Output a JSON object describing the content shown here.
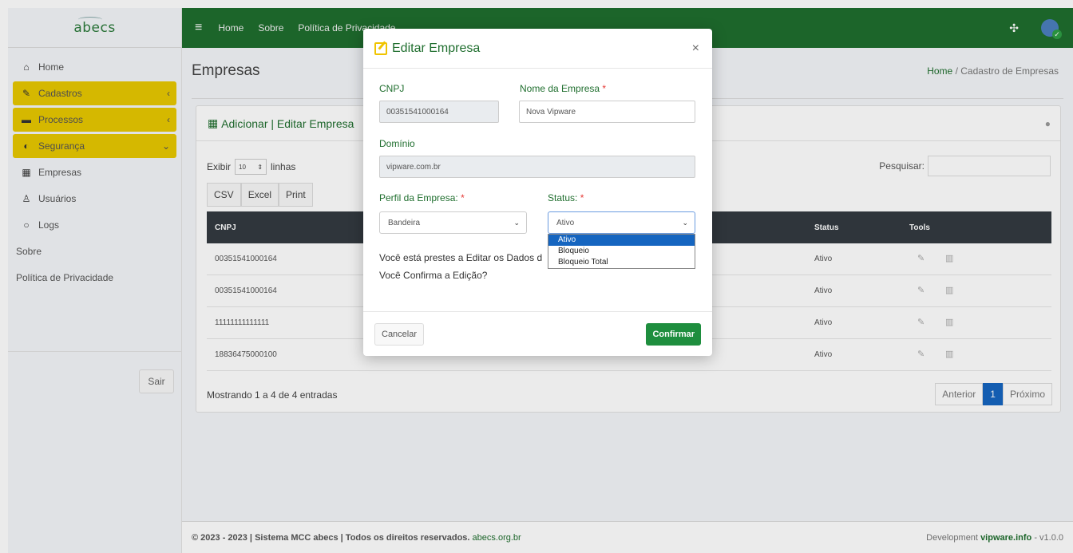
{
  "brand": {
    "name": "abecs"
  },
  "sidebar": {
    "items": [
      {
        "label": "Home",
        "icon": "home-icon",
        "glyph": "⌂"
      },
      {
        "label": "Cadastros",
        "icon": "edit-icon",
        "glyph": "✎"
      },
      {
        "label": "Processos",
        "icon": "server-icon",
        "glyph": "▬"
      },
      {
        "label": "Segurança",
        "icon": "shield-icon",
        "glyph": "◐"
      },
      {
        "label": "Empresas",
        "icon": "building-icon",
        "glyph": "▦"
      },
      {
        "label": "Usuários",
        "icon": "user-icon",
        "glyph": "♙"
      },
      {
        "label": "Logs",
        "icon": "comment-icon",
        "glyph": "○"
      },
      {
        "label": "Sobre"
      },
      {
        "label": "Política de Privacidade"
      }
    ],
    "logout_label": "Sair"
  },
  "topbar": {
    "links": [
      "Home",
      "Sobre",
      "Política de Privacidade"
    ]
  },
  "page": {
    "title": "Empresas",
    "breadcrumb_home": "Home",
    "breadcrumb_sep": "/",
    "breadcrumb_current": "Cadastro de Empresas"
  },
  "card": {
    "title": "Adicionar | Editar Empresa",
    "show_label": "Exibir",
    "show_value": "10",
    "show_suffix": "linhas",
    "search_label": "Pesquisar:",
    "export_buttons": [
      "CSV",
      "Excel",
      "Print"
    ],
    "columns": [
      "CNPJ",
      "Status",
      "Tools"
    ],
    "rows": [
      {
        "cnpj": "00351541000164",
        "status": "Ativo"
      },
      {
        "cnpj": "00351541000164",
        "status": "Ativo"
      },
      {
        "cnpj": "11111111111111",
        "status": "Ativo"
      },
      {
        "cnpj": "18836475000100",
        "status": "Ativo"
      }
    ],
    "footer_text": "Mostrando 1 a 4 de 4 entradas",
    "pager": {
      "prev": "Anterior",
      "current": "1",
      "next": "Próximo"
    }
  },
  "footer": {
    "left_text": "© 2023 - 2023 | Sistema MCC abecs | Todos os direitos reservados.",
    "left_link": "abecs.org.br",
    "right_text": "Development",
    "right_link": "vipware.info",
    "version": "- v1.0.0"
  },
  "modal": {
    "title": "Editar Empresa",
    "close": "×",
    "cnpj_label": "CNPJ",
    "cnpj_value": "00351541000164",
    "nome_label": "Nome da Empresa",
    "nome_value": "Nova Vipware",
    "dominio_label": "Domínio",
    "dominio_value": "vipware.com.br",
    "perfil_label": "Perfil da Empresa:",
    "perfil_value": "Bandeira",
    "status_label": "Status:",
    "status_value": "Ativo",
    "status_options": [
      "Ativo",
      "Bloqueio",
      "Bloqueio Total"
    ],
    "message_line1": "Você está prestes a Editar os Dados d",
    "message_line2": "Você Confirma a Edição?",
    "cancel_label": "Cancelar",
    "confirm_label": "Confirmar",
    "required_mark": "*"
  },
  "colors": {
    "brand_green": "#1f6e2e",
    "highlight_yellow": "#e8c800",
    "confirm_green": "#1e8e3e",
    "selected_blue": "#1565c0"
  }
}
